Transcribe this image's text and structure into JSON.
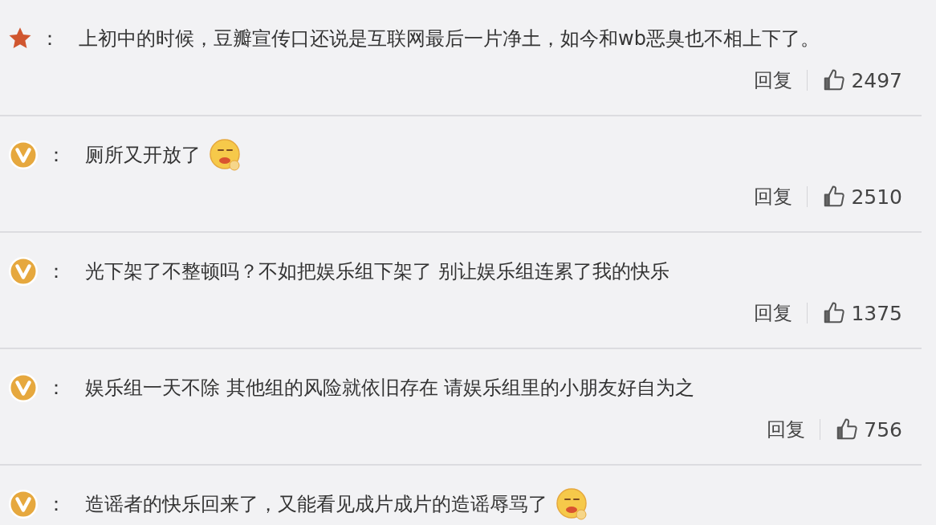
{
  "comments": [
    {
      "kind": "star",
      "separator": "：",
      "text": "上初中的时候，豆瓣宣传口还说是互联网最后一片净土，如今和wb恶臭也不相上下了。",
      "emoji": false,
      "reply": "回复",
      "likes": "2497"
    },
    {
      "kind": "vip",
      "separator": "：",
      "text": "厕所又开放了",
      "emoji": true,
      "reply": "回复",
      "likes": "2510"
    },
    {
      "kind": "vip",
      "separator": "：",
      "text": "光下架了不整顿吗？不如把娱乐组下架了 别让娱乐组连累了我的快乐",
      "emoji": false,
      "reply": "回复",
      "likes": "1375"
    },
    {
      "kind": "vip",
      "separator": "：",
      "text": "娱乐组一天不除 其他组的风险就依旧存在 请娱乐组里的小朋友好自为之",
      "emoji": false,
      "reply": "回复",
      "likes": "756"
    },
    {
      "kind": "vip",
      "separator": "：",
      "text": "造谣者的快乐回来了，又能看见成片成片的造谣辱骂了",
      "emoji": true
    }
  ]
}
